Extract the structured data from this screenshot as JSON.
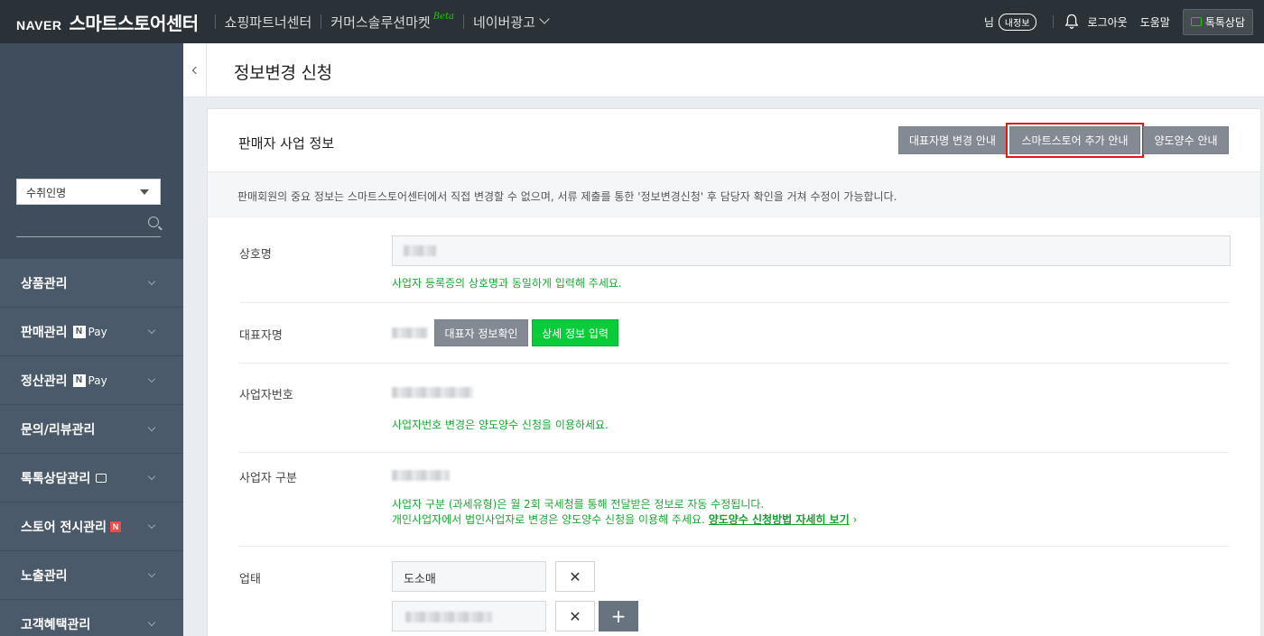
{
  "topbar": {
    "brand_logo": "NAVER",
    "brand_title": "스마트스토어센터",
    "nav": [
      "쇼핑파트너센터",
      "커머스솔루션마켓",
      "네이버광고"
    ],
    "beta_label": "Beta",
    "user_suffix": "님",
    "myinfo_label": "내정보",
    "logout_label": "로그아웃",
    "help_label": "도움말",
    "talk_label": "톡톡상담"
  },
  "sidebar": {
    "store_select_value": "수취인명",
    "menu": [
      {
        "label": "상품관리"
      },
      {
        "label": "판매관리",
        "badge": "Pay"
      },
      {
        "label": "정산관리",
        "badge": "Pay"
      },
      {
        "label": "문의/리뷰관리"
      },
      {
        "label": "톡톡상담관리"
      },
      {
        "label": "스토어 전시관리"
      },
      {
        "label": "노출관리"
      },
      {
        "label": "고객혜택관리"
      }
    ],
    "npay_n": "N",
    "new_badge": "N"
  },
  "page": {
    "title": "정보변경 신청"
  },
  "card": {
    "title": "판매자 사업 정보",
    "buttons": [
      "대표자명 변경 안내",
      "스마트스토어 추가 안내",
      "양도양수 안내"
    ],
    "notice": "판매회원의 중요 정보는 스마트스토어센터에서 직접 변경할 수 없으며, 서류 제출를 통한 '정보변경신청' 후 담당자 확인을 거쳐 수정이 가능합니다.",
    "rows": {
      "company": {
        "label": "상호명",
        "help": "사업자 등록증의 상호명과 동일하게 입력해 주세요."
      },
      "ceo": {
        "label": "대표자명",
        "btn_check": "대표자 정보확인",
        "btn_detail": "상세 정보 입력"
      },
      "bizno": {
        "label": "사업자번호",
        "help": "사업자번호 변경은 양도양수 신청을 이용하세요."
      },
      "biztype": {
        "label": "사업자 구분",
        "help1": "사업자 구분 (과세유형)은 월 2회 국세청를 통해 전달받은 정보로 자동 수정됩니다.",
        "help2": "개인사업자에서 법인사업자로 변경은 양도양수 신청을 이용해 주세요.",
        "help_link": "양도양수 신청방법 자세히 보기",
        "help_link_arrow": "›"
      },
      "industry": {
        "label": "업태",
        "value1": "도소매",
        "x_symbol": "✕",
        "plus_symbol": "+"
      }
    }
  }
}
